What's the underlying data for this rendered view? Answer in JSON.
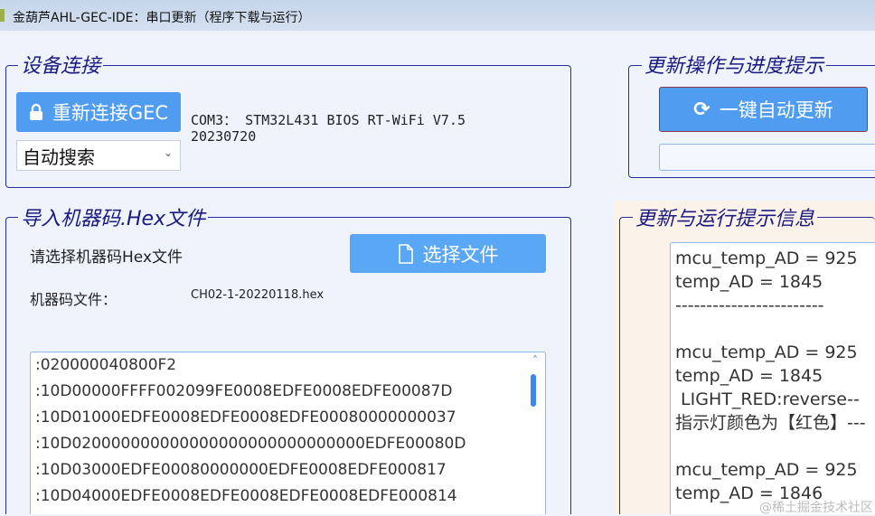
{
  "window": {
    "title": "金葫芦AHL-GEC-IDE：串口更新（程序下载与运行）"
  },
  "device": {
    "legend": "设备连接",
    "reconnect_label": "重新连接GEC",
    "port_select": "自动搜索",
    "status_line1": "COM3： STM32L431 BIOS RT-WiFi V7.5",
    "status_line2": "20230720"
  },
  "hex": {
    "legend": "导入机器码.Hex文件",
    "prompt": "请选择机器码Hex文件",
    "choose_label": "选择文件",
    "file_label": "机器码文件：",
    "file_name": "CH02-1-20220118.hex",
    "lines": [
      ":020000040800F2",
      ":10D00000FFFF002099FE0008EDFE0008EDFE00087D",
      ":10D01000EDFE0008EDFE0008EDFE00080000000037",
      ":10D020000000000000000000000000000EDFE00080D",
      ":10D03000EDFE00080000000EDFE0008EDFE000817",
      ":10D04000EDFE0008EDFE0008EDFE0008EDFE000814"
    ]
  },
  "update": {
    "legend": "更新操作与进度提示",
    "auto_update_label": "一键自动更新",
    "progress": 0
  },
  "log": {
    "legend": "更新与运行提示信息",
    "lines": [
      "mcu_temp_AD = 925",
      "temp_AD = 1845",
      "------------------------",
      "",
      "mcu_temp_AD = 925",
      "temp_AD = 1845",
      " LIGHT_RED:reverse--",
      "指示灯颜色为【红色】---",
      "",
      "mcu_temp_AD = 925",
      "temp_AD = 1846"
    ]
  },
  "watermark": "@稀土掘金技术社区",
  "colors": {
    "button_blue": "#4f9cf0",
    "legend": "#1a1a80",
    "log_panel": "#fbf3ea"
  }
}
